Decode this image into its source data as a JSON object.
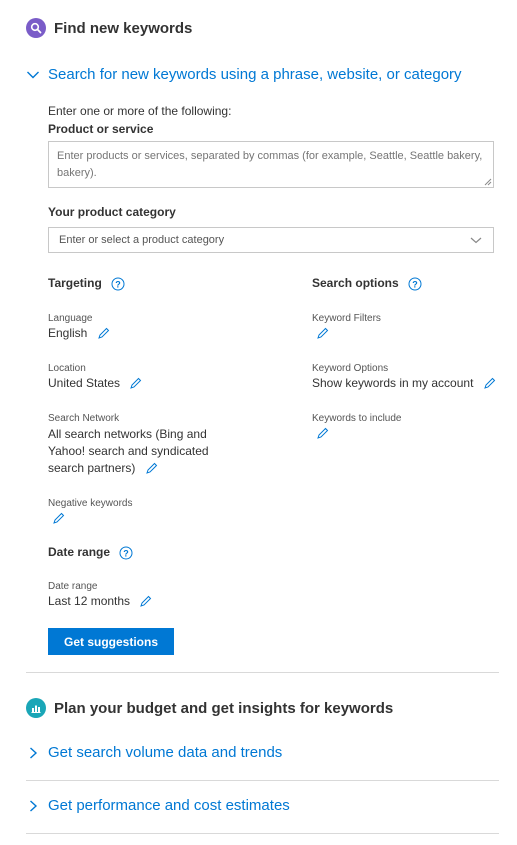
{
  "find": {
    "title": "Find new keywords",
    "search_link": "Search for new keywords using a phrase, website, or category",
    "intro": "Enter one or more of the following:",
    "product_label": "Product or service",
    "product_placeholder": "Enter products or services, separated by commas (for example, Seattle, Seattle bakery, bakery).",
    "category_label": "Your product category",
    "category_placeholder": "Enter or select a product category",
    "targeting": {
      "title": "Targeting",
      "language_label": "Language",
      "language_value": "English",
      "location_label": "Location",
      "location_value": "United States",
      "network_label": "Search Network",
      "network_value_1": "All search networks (Bing and",
      "network_value_2": "Yahoo! search and syndicated",
      "network_value_3": "search partners)",
      "negative_label": "Negative keywords"
    },
    "search_options": {
      "title": "Search options",
      "filters_label": "Keyword Filters",
      "options_label": "Keyword Options",
      "options_value": "Show keywords in my account",
      "include_label": "Keywords to include"
    },
    "date": {
      "title": "Date range",
      "label": "Date range",
      "value": "Last 12 months"
    },
    "get_suggestions": "Get suggestions"
  },
  "plan": {
    "title": "Plan your budget and get insights for keywords",
    "volume_link": "Get search volume data and trends",
    "performance_link": "Get performance and cost estimates"
  },
  "colors": {
    "accent": "#0078d4",
    "find_icon_bg": "#7a5cc8",
    "plan_icon_bg": "#1aa6b7"
  }
}
